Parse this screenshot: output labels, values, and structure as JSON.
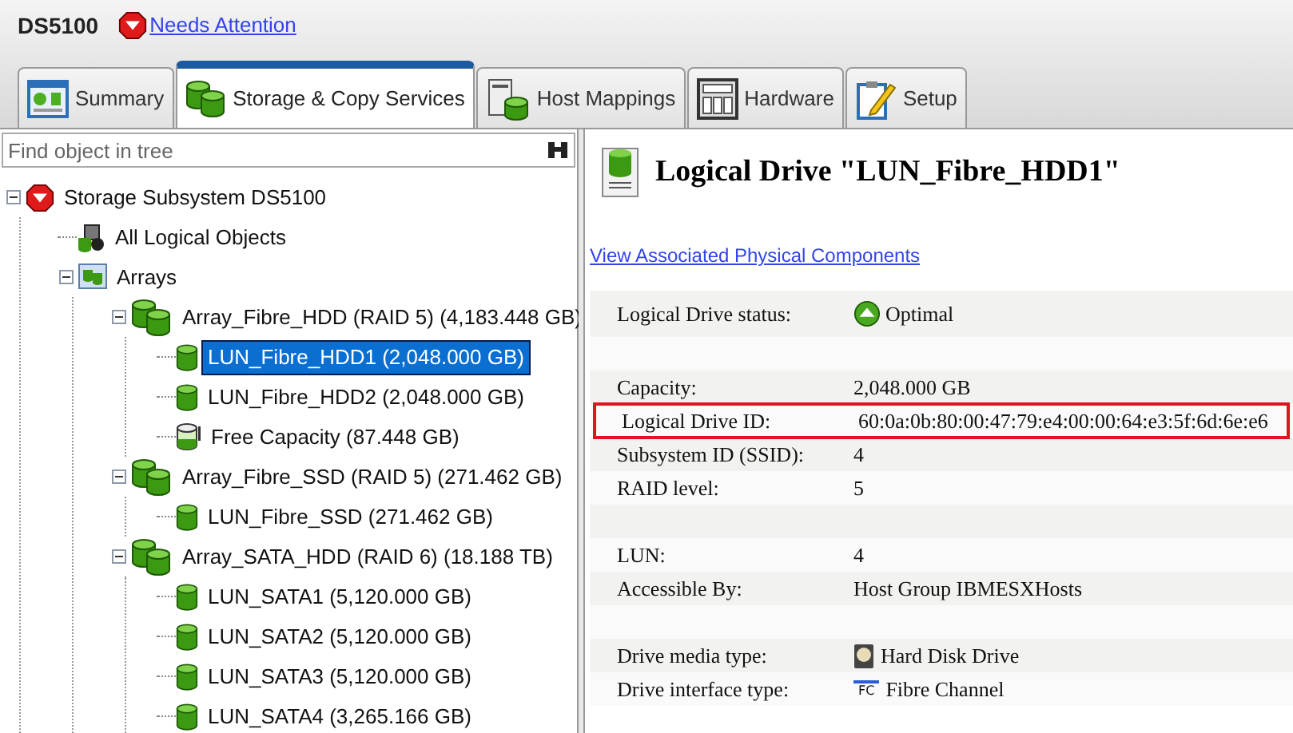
{
  "header": {
    "title": "DS5100",
    "status_link": "Needs Attention"
  },
  "tabs": [
    {
      "label": "Summary",
      "kind": "summary",
      "selected": false
    },
    {
      "label": "Storage & Copy Services",
      "kind": "storage",
      "selected": true
    },
    {
      "label": "Host Mappings",
      "kind": "hosts",
      "selected": false
    },
    {
      "label": "Hardware",
      "kind": "hardware",
      "selected": false
    },
    {
      "label": "Setup",
      "kind": "setup",
      "selected": false
    }
  ],
  "search": {
    "placeholder": "Find object in tree"
  },
  "tree": [
    {
      "label": "Storage Subsystem DS5100",
      "kind": "subsystem",
      "selected": false,
      "expanded": true,
      "children": [
        {
          "label": "All Logical Objects",
          "kind": "objects",
          "selected": false
        },
        {
          "label": "Arrays",
          "kind": "arrays",
          "selected": false,
          "expanded": true,
          "children": [
            {
              "label": "Array_Fibre_HDD (RAID 5) (4,183.448 GB)",
              "kind": "array",
              "selected": false,
              "expanded": true,
              "children": [
                {
                  "label": "LUN_Fibre_HDD1 (2,048.000 GB)",
                  "kind": "lun",
                  "selected": true
                },
                {
                  "label": "LUN_Fibre_HDD2 (2,048.000 GB)",
                  "kind": "lun",
                  "selected": false
                },
                {
                  "label": "Free Capacity (87.448 GB)",
                  "kind": "free",
                  "selected": false
                }
              ]
            },
            {
              "label": "Array_Fibre_SSD (RAID 5) (271.462 GB)",
              "kind": "array",
              "selected": false,
              "expanded": true,
              "children": [
                {
                  "label": "LUN_Fibre_SSD (271.462 GB)",
                  "kind": "lun",
                  "selected": false
                }
              ]
            },
            {
              "label": "Array_SATA_HDD (RAID 6) (18.188 TB)",
              "kind": "array",
              "selected": false,
              "expanded": true,
              "children": [
                {
                  "label": "LUN_SATA1 (5,120.000 GB)",
                  "kind": "lun",
                  "selected": false
                },
                {
                  "label": "LUN_SATA2 (5,120.000 GB)",
                  "kind": "lun",
                  "selected": false
                },
                {
                  "label": "LUN_SATA3 (5,120.000 GB)",
                  "kind": "lun",
                  "selected": false
                },
                {
                  "label": "LUN_SATA4 (3,265.166 GB)",
                  "kind": "lun",
                  "selected": false
                }
              ]
            }
          ]
        }
      ]
    }
  ],
  "details": {
    "title": "Logical Drive \"LUN_Fibre_HDD1\"",
    "link": "View Associated Physical Components",
    "rows": [
      {
        "kind": "status",
        "label": "Logical Drive status:",
        "value": "Optimal"
      },
      {
        "kind": "blank"
      },
      {
        "kind": "text",
        "label": "Capacity:",
        "value": "2,048.000 GB",
        "highlighted": false
      },
      {
        "kind": "text",
        "label": "Logical Drive ID:",
        "value": "60:0a:0b:80:00:47:79:e4:00:00:64:e3:5f:6d:6e:e6",
        "highlighted": true
      },
      {
        "kind": "text",
        "label": "Subsystem ID (SSID):",
        "value": "4",
        "highlighted": false
      },
      {
        "kind": "text",
        "label": "RAID level:",
        "value": "5",
        "highlighted": false
      },
      {
        "kind": "blank"
      },
      {
        "kind": "text",
        "label": "LUN:",
        "value": "4",
        "highlighted": false
      },
      {
        "kind": "text",
        "label": "Accessible By:",
        "value": "Host Group IBMESXHosts",
        "highlighted": false
      },
      {
        "kind": "blank"
      },
      {
        "kind": "media",
        "label": "Drive media type:",
        "value": "Hard Disk Drive"
      },
      {
        "kind": "interface",
        "label": "Drive interface type:",
        "value": "Fibre Channel",
        "icon_text": "FC"
      }
    ]
  }
}
